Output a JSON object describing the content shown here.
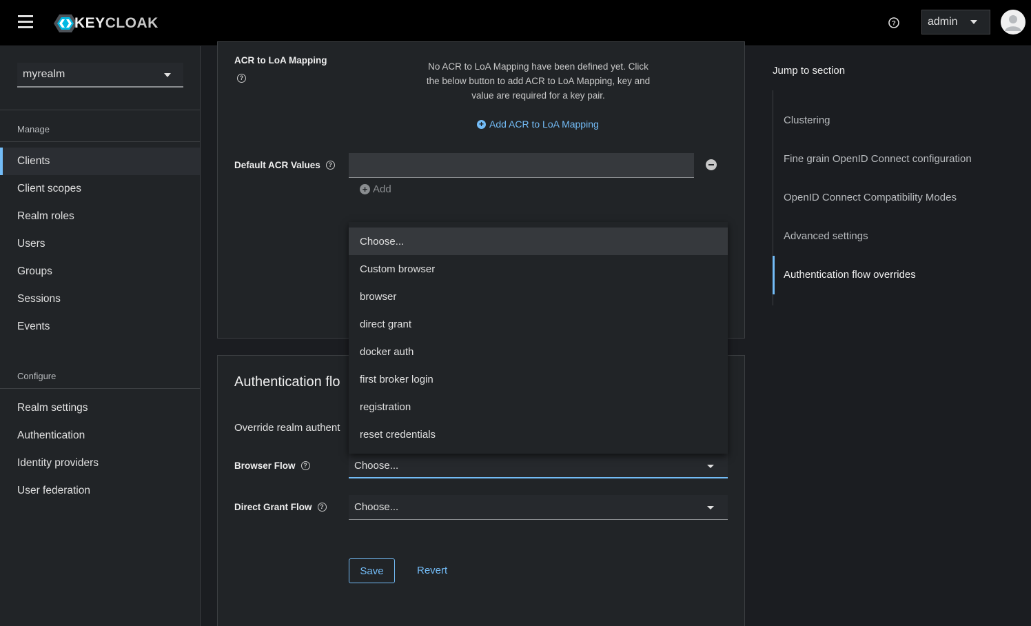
{
  "header": {
    "logo_text_a": "KEY",
    "logo_text_b": "CLOAK",
    "user_label": "admin",
    "icons": [
      "menu-icon",
      "help-icon",
      "caret-down-icon",
      "user-avatar-icon"
    ]
  },
  "sidebar": {
    "realm": "myrealm",
    "manage_label": "Manage",
    "manage_items": [
      {
        "label": "Clients",
        "active": true
      },
      {
        "label": "Client scopes"
      },
      {
        "label": "Realm roles"
      },
      {
        "label": "Users"
      },
      {
        "label": "Groups"
      },
      {
        "label": "Sessions"
      },
      {
        "label": "Events"
      }
    ],
    "configure_label": "Configure",
    "configure_items": [
      {
        "label": "Realm settings"
      },
      {
        "label": "Authentication"
      },
      {
        "label": "Identity providers"
      },
      {
        "label": "User federation"
      }
    ]
  },
  "acr": {
    "mapping_label": "ACR to LoA Mapping",
    "empty_line1": "No ACR to LoA Mapping have been defined yet. Click",
    "empty_line2": "the below button to add ACR to LoA Mapping, key and",
    "empty_line3": "value are required for a key pair.",
    "add_mapping_label": "Add ACR to LoA Mapping",
    "default_acr_label": "Default ACR Values",
    "default_acr_value": "",
    "add_label": "Add"
  },
  "auth_flow": {
    "title": "Authentication flow overrides",
    "title_visible": "Authentication flo",
    "desc_visible": "Override realm authent",
    "browser_flow_label": "Browser Flow",
    "browser_flow_value": "Choose...",
    "direct_grant_label": "Direct Grant Flow",
    "direct_grant_value": "Choose...",
    "save_label": "Save",
    "revert_label": "Revert"
  },
  "dropdown": {
    "options": [
      "Choose...",
      "Custom browser",
      "browser",
      "direct grant",
      "docker auth",
      "first broker login",
      "registration",
      "reset credentials"
    ],
    "highlighted": "Choose..."
  },
  "jump": {
    "title": "Jump to section",
    "items": [
      {
        "label": "Clustering"
      },
      {
        "label": "Fine grain OpenID Connect configuration"
      },
      {
        "label": "OpenID Connect Compatibility Modes"
      },
      {
        "label": "Advanced settings"
      },
      {
        "label": "Authentication flow overrides",
        "active": true
      }
    ]
  },
  "colors": {
    "accent": "#73bcf7",
    "header_bg": "#000000",
    "sidebar_bg": "#212427",
    "page_bg": "#1b1d21"
  }
}
